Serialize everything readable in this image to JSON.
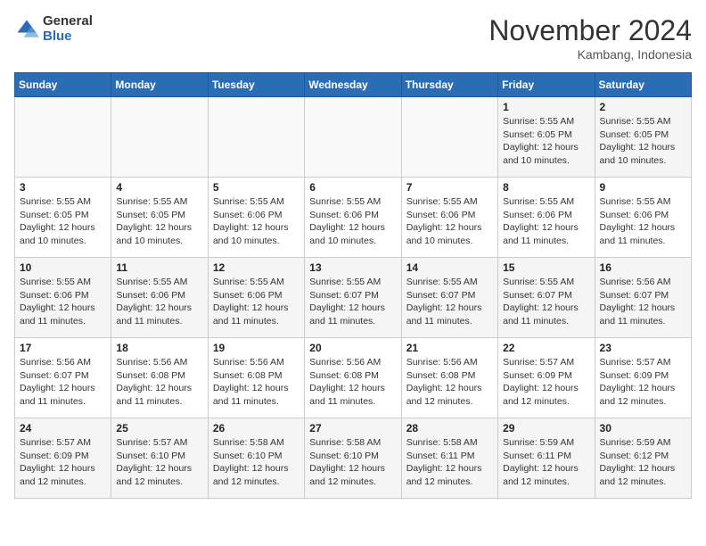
{
  "header": {
    "logo_general": "General",
    "logo_blue": "Blue",
    "title": "November 2024",
    "subtitle": "Kambang, Indonesia"
  },
  "weekdays": [
    "Sunday",
    "Monday",
    "Tuesday",
    "Wednesday",
    "Thursday",
    "Friday",
    "Saturday"
  ],
  "weeks": [
    [
      {
        "day": "",
        "info": ""
      },
      {
        "day": "",
        "info": ""
      },
      {
        "day": "",
        "info": ""
      },
      {
        "day": "",
        "info": ""
      },
      {
        "day": "",
        "info": ""
      },
      {
        "day": "1",
        "info": "Sunrise: 5:55 AM\nSunset: 6:05 PM\nDaylight: 12 hours\nand 10 minutes."
      },
      {
        "day": "2",
        "info": "Sunrise: 5:55 AM\nSunset: 6:05 PM\nDaylight: 12 hours\nand 10 minutes."
      }
    ],
    [
      {
        "day": "3",
        "info": "Sunrise: 5:55 AM\nSunset: 6:05 PM\nDaylight: 12 hours\nand 10 minutes."
      },
      {
        "day": "4",
        "info": "Sunrise: 5:55 AM\nSunset: 6:05 PM\nDaylight: 12 hours\nand 10 minutes."
      },
      {
        "day": "5",
        "info": "Sunrise: 5:55 AM\nSunset: 6:06 PM\nDaylight: 12 hours\nand 10 minutes."
      },
      {
        "day": "6",
        "info": "Sunrise: 5:55 AM\nSunset: 6:06 PM\nDaylight: 12 hours\nand 10 minutes."
      },
      {
        "day": "7",
        "info": "Sunrise: 5:55 AM\nSunset: 6:06 PM\nDaylight: 12 hours\nand 10 minutes."
      },
      {
        "day": "8",
        "info": "Sunrise: 5:55 AM\nSunset: 6:06 PM\nDaylight: 12 hours\nand 11 minutes."
      },
      {
        "day": "9",
        "info": "Sunrise: 5:55 AM\nSunset: 6:06 PM\nDaylight: 12 hours\nand 11 minutes."
      }
    ],
    [
      {
        "day": "10",
        "info": "Sunrise: 5:55 AM\nSunset: 6:06 PM\nDaylight: 12 hours\nand 11 minutes."
      },
      {
        "day": "11",
        "info": "Sunrise: 5:55 AM\nSunset: 6:06 PM\nDaylight: 12 hours\nand 11 minutes."
      },
      {
        "day": "12",
        "info": "Sunrise: 5:55 AM\nSunset: 6:06 PM\nDaylight: 12 hours\nand 11 minutes."
      },
      {
        "day": "13",
        "info": "Sunrise: 5:55 AM\nSunset: 6:07 PM\nDaylight: 12 hours\nand 11 minutes."
      },
      {
        "day": "14",
        "info": "Sunrise: 5:55 AM\nSunset: 6:07 PM\nDaylight: 12 hours\nand 11 minutes."
      },
      {
        "day": "15",
        "info": "Sunrise: 5:55 AM\nSunset: 6:07 PM\nDaylight: 12 hours\nand 11 minutes."
      },
      {
        "day": "16",
        "info": "Sunrise: 5:56 AM\nSunset: 6:07 PM\nDaylight: 12 hours\nand 11 minutes."
      }
    ],
    [
      {
        "day": "17",
        "info": "Sunrise: 5:56 AM\nSunset: 6:07 PM\nDaylight: 12 hours\nand 11 minutes."
      },
      {
        "day": "18",
        "info": "Sunrise: 5:56 AM\nSunset: 6:08 PM\nDaylight: 12 hours\nand 11 minutes."
      },
      {
        "day": "19",
        "info": "Sunrise: 5:56 AM\nSunset: 6:08 PM\nDaylight: 12 hours\nand 11 minutes."
      },
      {
        "day": "20",
        "info": "Sunrise: 5:56 AM\nSunset: 6:08 PM\nDaylight: 12 hours\nand 11 minutes."
      },
      {
        "day": "21",
        "info": "Sunrise: 5:56 AM\nSunset: 6:08 PM\nDaylight: 12 hours\nand 12 minutes."
      },
      {
        "day": "22",
        "info": "Sunrise: 5:57 AM\nSunset: 6:09 PM\nDaylight: 12 hours\nand 12 minutes."
      },
      {
        "day": "23",
        "info": "Sunrise: 5:57 AM\nSunset: 6:09 PM\nDaylight: 12 hours\nand 12 minutes."
      }
    ],
    [
      {
        "day": "24",
        "info": "Sunrise: 5:57 AM\nSunset: 6:09 PM\nDaylight: 12 hours\nand 12 minutes."
      },
      {
        "day": "25",
        "info": "Sunrise: 5:57 AM\nSunset: 6:10 PM\nDaylight: 12 hours\nand 12 minutes."
      },
      {
        "day": "26",
        "info": "Sunrise: 5:58 AM\nSunset: 6:10 PM\nDaylight: 12 hours\nand 12 minutes."
      },
      {
        "day": "27",
        "info": "Sunrise: 5:58 AM\nSunset: 6:10 PM\nDaylight: 12 hours\nand 12 minutes."
      },
      {
        "day": "28",
        "info": "Sunrise: 5:58 AM\nSunset: 6:11 PM\nDaylight: 12 hours\nand 12 minutes."
      },
      {
        "day": "29",
        "info": "Sunrise: 5:59 AM\nSunset: 6:11 PM\nDaylight: 12 hours\nand 12 minutes."
      },
      {
        "day": "30",
        "info": "Sunrise: 5:59 AM\nSunset: 6:12 PM\nDaylight: 12 hours\nand 12 minutes."
      }
    ]
  ]
}
